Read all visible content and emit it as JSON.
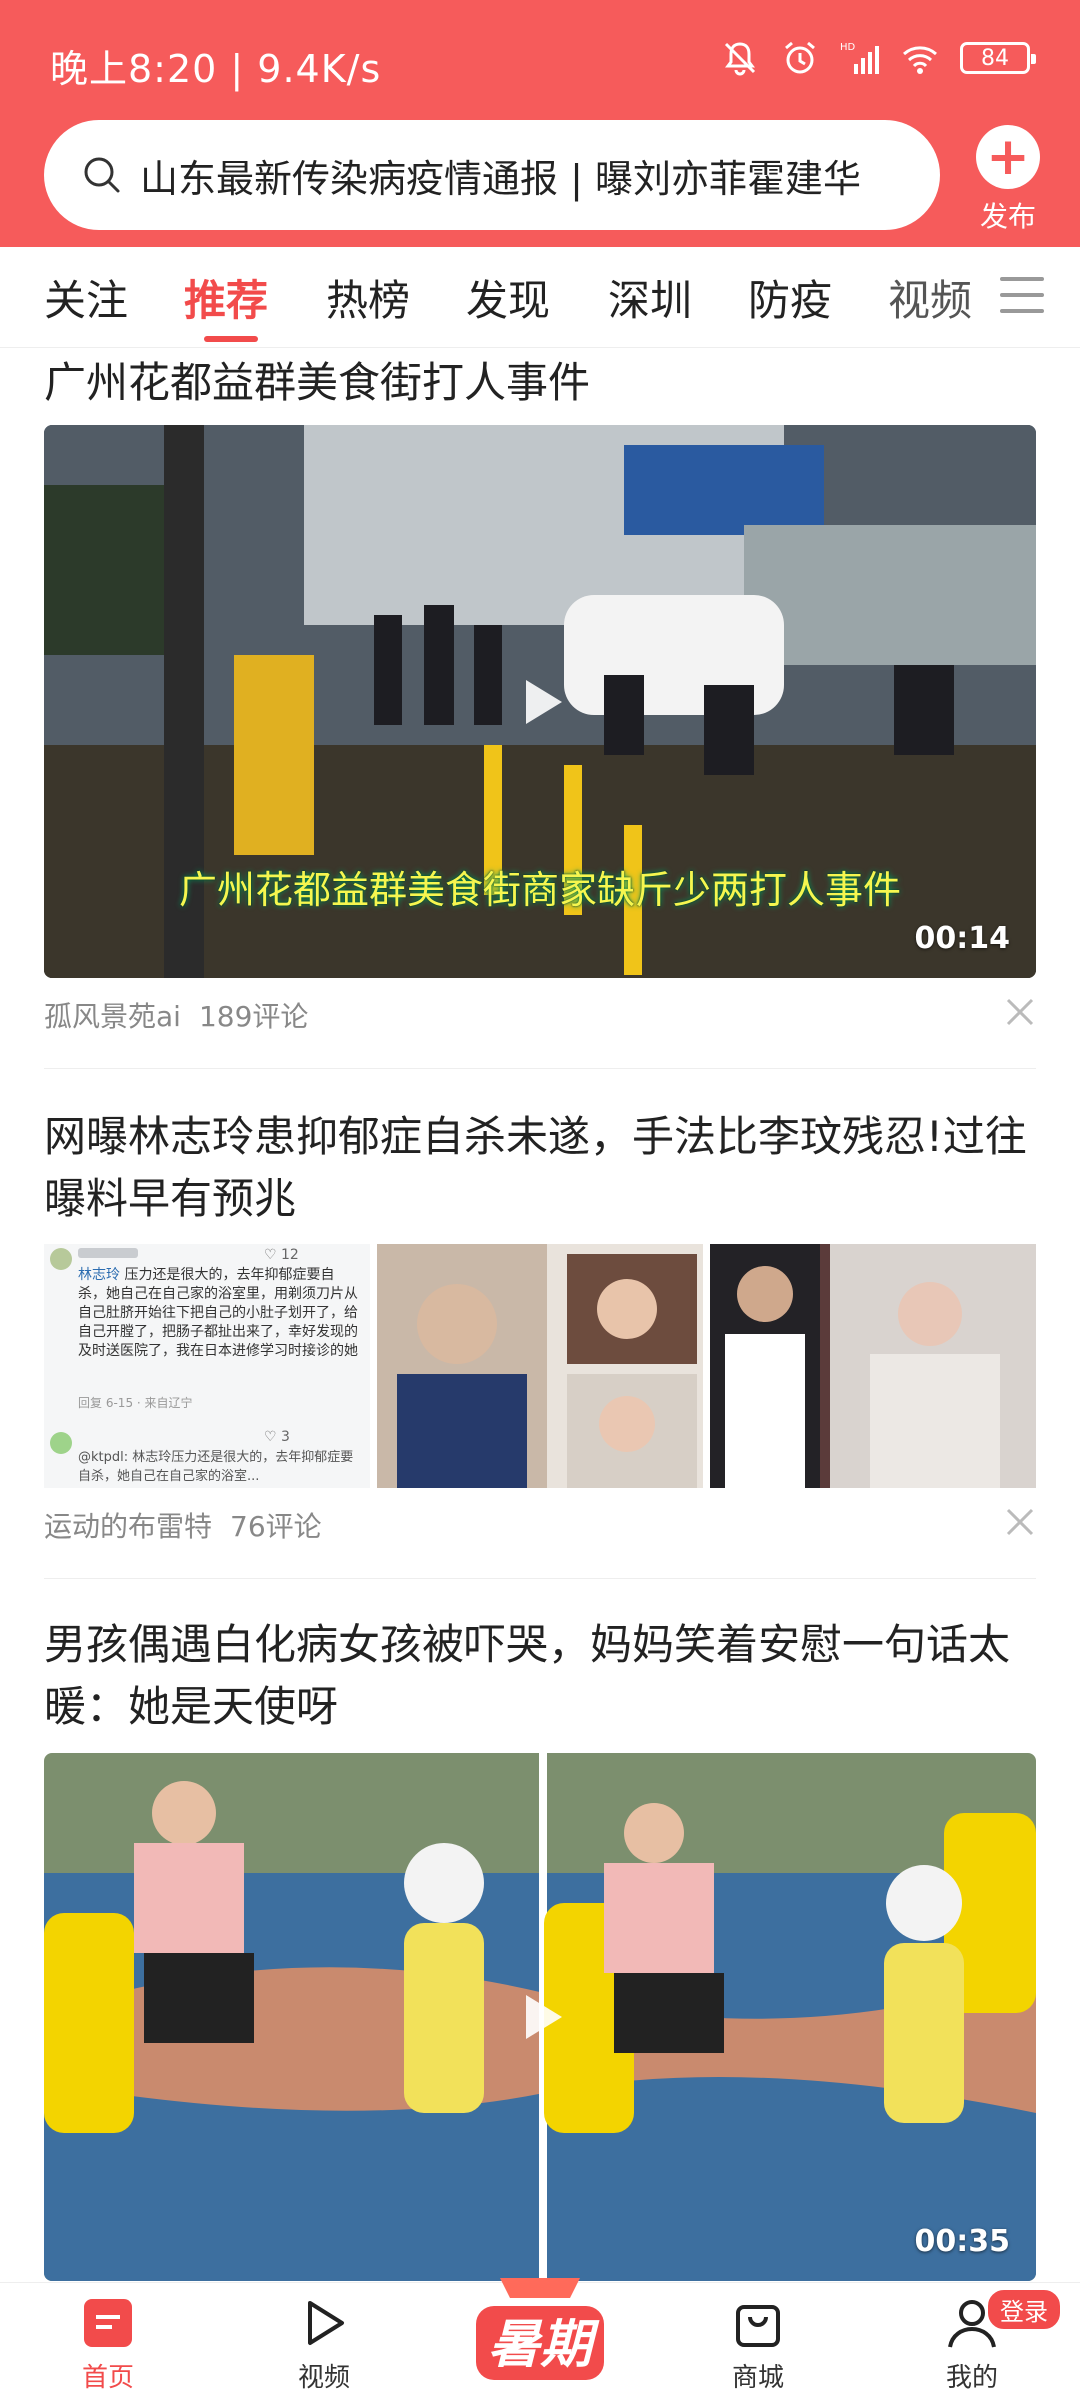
{
  "status_bar": {
    "time": "晚上8:20 | 9.4K/s",
    "battery": "84"
  },
  "search": {
    "placeholder": "山东最新传染病疫情通报 | 曝刘亦菲霍建华"
  },
  "publish": {
    "label": "发布"
  },
  "tabs": [
    {
      "label": "关注"
    },
    {
      "label": "推荐",
      "active": true
    },
    {
      "label": "热榜"
    },
    {
      "label": "发现"
    },
    {
      "label": "深圳"
    },
    {
      "label": "防疫"
    },
    {
      "label": "视频"
    }
  ],
  "feed": [
    {
      "title": "广州花都益群美食街打人事件",
      "video_caption": "广州花都益群美食街商家缺斤少两打人事件",
      "duration": "00:14",
      "author": "孤风景苑ai",
      "comments": "189评论"
    },
    {
      "title": "网曝林志玲患抑郁症自杀未遂，手法比李玟残忍!过往曝料早有预兆",
      "author": "运动的布雷特",
      "comments": "76评论",
      "comment_preview": {
        "c1_name": "林志玲",
        "c1_text": "压力还是很大的，去年抑郁症要自杀，她自己在自己家的浴室里，用剃须刀片从自己肚脐开始往下把自己的小肚子划开了，给自己开膛了，把肠子都扯出来了，幸好发现的及时送医院了，我在日本进修学习时接诊的她",
        "c1_reply": "回复",
        "c1_date": "6-15 · 来自辽宁",
        "c1_likes": "12",
        "c2_name": "@ktpdl:",
        "c2_text": "林志玲压力还是很大的，去年抑郁症要自杀，她自己在自己家的浴室...",
        "c2_likes": "3"
      }
    },
    {
      "title": "男孩偶遇白化病女孩被吓哭，妈妈笑着安慰一句话太暖：她是天使呀",
      "duration": "00:35"
    }
  ],
  "bottom_nav": [
    {
      "label": "首页",
      "active": true
    },
    {
      "label": "视频"
    },
    {
      "label": "暑期"
    },
    {
      "label": "商城"
    },
    {
      "label": "我的"
    }
  ],
  "login_badge": "登录",
  "colors": {
    "accent": "#f24b4b",
    "header": "#f65b5b"
  }
}
